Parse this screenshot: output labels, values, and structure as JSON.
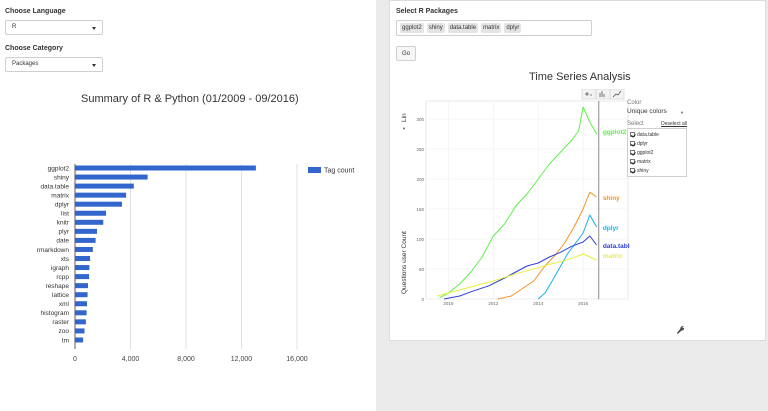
{
  "left": {
    "language": {
      "label": "Choose Language",
      "value": "R"
    },
    "category": {
      "label": "Choose Category",
      "value": "Packages"
    }
  },
  "right": {
    "packages_label": "Select R Packages",
    "packages": [
      "ggplot2",
      "shiny",
      "data.table",
      "matrix",
      "dplyr"
    ],
    "go_label": "Go",
    "toolbar_icons": [
      "select-icon",
      "bar-icon",
      "line-icon"
    ],
    "legend": {
      "color_heading": "Color",
      "color_value": "Unique colors",
      "select_heading": "Select",
      "deselect_label": "Deselect all",
      "items": [
        "data.table",
        "dplyr",
        "ggplot2",
        "matrix",
        "shiny"
      ]
    },
    "settings_icon": "wrench-icon"
  },
  "chart_data": [
    {
      "type": "bar",
      "orientation": "horizontal",
      "title": "Summary of R & Python (01/2009 - 09/2016)",
      "categories": [
        "ggplot2",
        "shiny",
        "data.table",
        "matrix",
        "dplyr",
        "list",
        "knitr",
        "plyr",
        "date",
        "rmarkdown",
        "xts",
        "igraph",
        "rcpp",
        "reshape",
        "lattice",
        "xml",
        "histogram",
        "raster",
        "zoo",
        "tm"
      ],
      "series": [
        {
          "name": "Tag count",
          "values": [
            13000,
            5200,
            4200,
            3650,
            3350,
            2200,
            2000,
            1550,
            1450,
            1250,
            1050,
            1000,
            980,
            900,
            870,
            830,
            800,
            750,
            650,
            550
          ]
        }
      ],
      "xlim": [
        0,
        16000
      ],
      "x_ticks": [
        "0",
        "4,000",
        "8,000",
        "12,000",
        "16,000"
      ],
      "grid": true,
      "legend_position": "right",
      "colors": {
        "bar": "#3366cc"
      }
    },
    {
      "type": "line",
      "title": "Time Series Analysis",
      "ylabel": "Questions user Count",
      "y_axis_toggle": "Lin",
      "x_ticks": [
        "2010",
        "2012",
        "2014",
        "2016"
      ],
      "y_ticks": [
        "0",
        "50",
        "100",
        "150",
        "200",
        "250",
        "300"
      ],
      "xlim": [
        2009,
        2018
      ],
      "ylim": [
        0,
        330
      ],
      "cursor_x": 2016.7,
      "series": [
        {
          "name": "ggplot2",
          "color": "#5ef04a",
          "label_y": 275,
          "points": [
            [
              2009.6,
              2
            ],
            [
              2010,
              10
            ],
            [
              2010.5,
              25
            ],
            [
              2011,
              45
            ],
            [
              2011.5,
              70
            ],
            [
              2012,
              105
            ],
            [
              2012.5,
              125
            ],
            [
              2013,
              155
            ],
            [
              2013.5,
              175
            ],
            [
              2014,
              200
            ],
            [
              2014.5,
              225
            ],
            [
              2015,
              245
            ],
            [
              2015.5,
              265
            ],
            [
              2015.8,
              280
            ],
            [
              2016,
              320
            ],
            [
              2016.3,
              295
            ],
            [
              2016.6,
              275
            ]
          ]
        },
        {
          "name": "shiny",
          "color": "#f39426",
          "label_y": 165,
          "points": [
            [
              2012.2,
              0
            ],
            [
              2012.8,
              5
            ],
            [
              2013.2,
              15
            ],
            [
              2013.8,
              30
            ],
            [
              2014.3,
              55
            ],
            [
              2014.8,
              75
            ],
            [
              2015.2,
              95
            ],
            [
              2015.6,
              120
            ],
            [
              2016,
              150
            ],
            [
              2016.3,
              178
            ],
            [
              2016.6,
              170
            ]
          ]
        },
        {
          "name": "dplyr",
          "color": "#1ab2e8",
          "label_y": 115,
          "points": [
            [
              2014,
              0
            ],
            [
              2014.3,
              10
            ],
            [
              2014.7,
              35
            ],
            [
              2015,
              55
            ],
            [
              2015.3,
              75
            ],
            [
              2015.7,
              95
            ],
            [
              2016,
              110
            ],
            [
              2016.3,
              140
            ],
            [
              2016.6,
              120
            ]
          ]
        },
        {
          "name": "data.table",
          "color": "#2f3fd6",
          "label_y": 85,
          "points": [
            [
              2009.8,
              0
            ],
            [
              2010.5,
              5
            ],
            [
              2011,
              12
            ],
            [
              2011.8,
              22
            ],
            [
              2012.5,
              35
            ],
            [
              2013,
              45
            ],
            [
              2013.5,
              55
            ],
            [
              2014,
              60
            ],
            [
              2014.5,
              70
            ],
            [
              2015,
              78
            ],
            [
              2015.5,
              88
            ],
            [
              2016,
              95
            ],
            [
              2016.3,
              105
            ],
            [
              2016.6,
              90
            ]
          ]
        },
        {
          "name": "matrix",
          "color": "#e8f03a",
          "label_y": 68,
          "points": [
            [
              2009.5,
              5
            ],
            [
              2010,
              10
            ],
            [
              2011,
              20
            ],
            [
              2012,
              30
            ],
            [
              2013,
              42
            ],
            [
              2014,
              52
            ],
            [
              2014.5,
              58
            ],
            [
              2015,
              62
            ],
            [
              2015.5,
              68
            ],
            [
              2016,
              75
            ],
            [
              2016.6,
              65
            ]
          ]
        }
      ]
    }
  ]
}
